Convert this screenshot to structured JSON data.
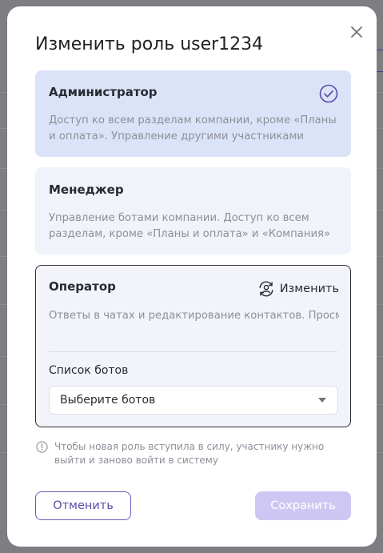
{
  "modal": {
    "title": "Изменить роль user1234",
    "close_icon": "close-icon",
    "roles": [
      {
        "name": "Администратор",
        "description": "Доступ ко всем разделам компании, кроме «Планы и оплата». Управление другими участниками",
        "selected": true
      },
      {
        "name": "Менеджер",
        "description": "Управление ботами компании. Доступ ко всем разделам, кроме «Планы и оплата» и «Компания»",
        "selected": false
      },
      {
        "name": "Оператор",
        "description": "Ответы в чатах и редактирование контактов. Просмотр сценариев, ИИ-ассистента, авторассылок",
        "selected": false,
        "change_label": "Изменить",
        "bots_label": "Список ботов",
        "bots_placeholder": "Выберите ботов"
      }
    ],
    "info_text": "Чтобы новая роль вступила в силу, участнику нужно выйти и заново войти в систему",
    "cancel_label": "Отменить",
    "save_label": "Сохранить"
  },
  "colors": {
    "accent": "#5a4aa8",
    "selected_card": "#dbe3f8",
    "save_disabled": "#cfc7f3"
  }
}
